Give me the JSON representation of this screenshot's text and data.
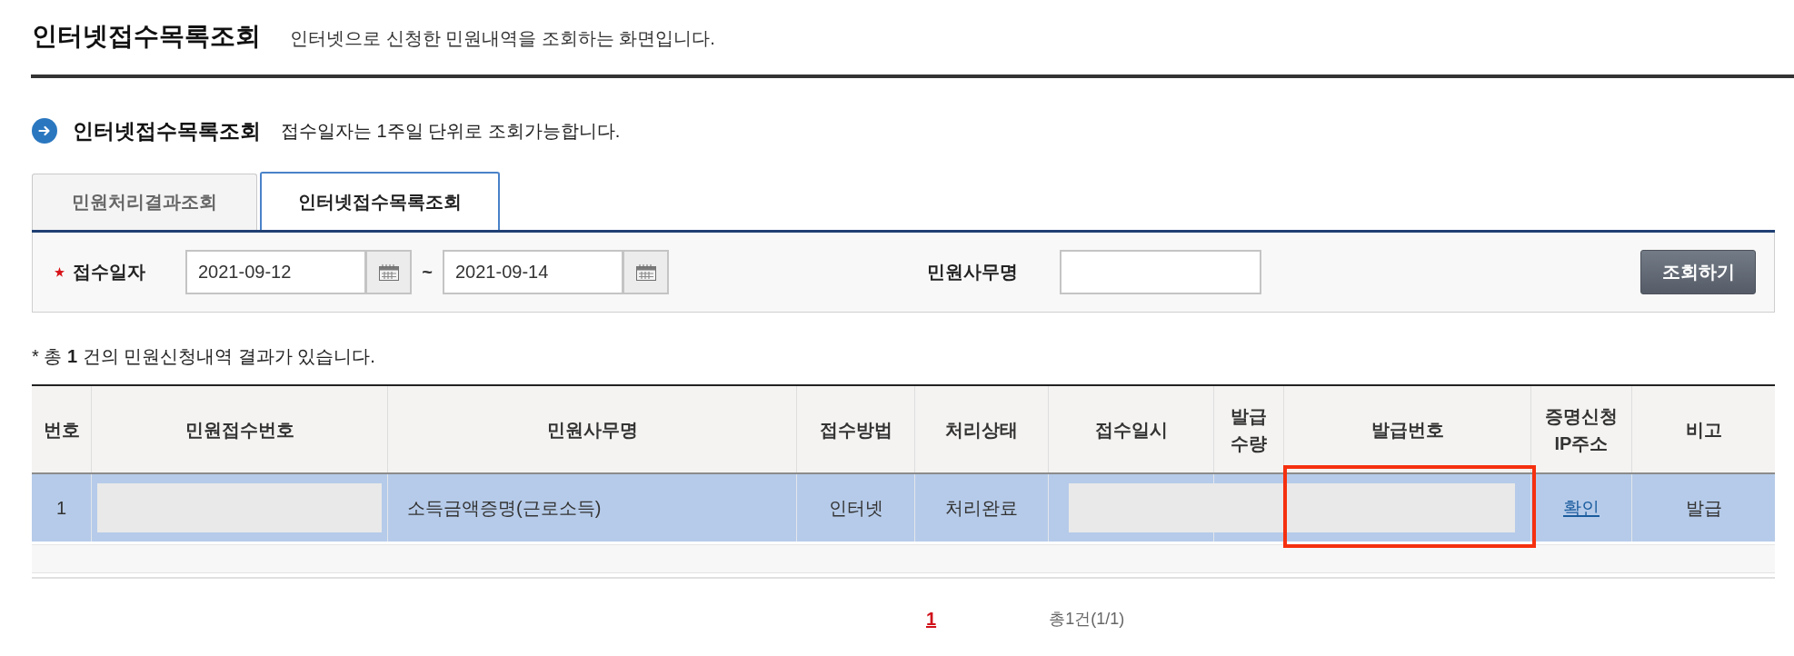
{
  "page_header": {
    "title": "인터넷접수목록조회",
    "description": "인터넷으로 신청한 민원내역을 조회하는 화면입니다."
  },
  "section": {
    "title": "인터넷접수목록조회",
    "note": "접수일자는 1주일 단위로 조회가능합니다."
  },
  "tabs": [
    {
      "label": "민원처리결과조회",
      "selected": false
    },
    {
      "label": "인터넷접수목록조회",
      "selected": true
    }
  ],
  "search": {
    "date_label": "접수일자",
    "required": true,
    "date_from": "2021-09-12",
    "range_separator": "~",
    "date_to": "2021-09-14",
    "name_label": "민원사무명",
    "button": "조회하기"
  },
  "result_summary": "* 총 **1** 건의 민원신청내역 결과가 있습니다.",
  "table": {
    "columns": [
      "번호",
      "민원접수번호",
      "민원사무명",
      "접수방법",
      "처리상태",
      "접수일시",
      "발급 수량",
      "발급번호",
      "증명신청 IP주소",
      "비고"
    ],
    "rows": [
      {
        "selected": true,
        "cells": [
          {
            "kind": "text",
            "text": "1",
            "marked": false
          },
          {
            "kind": "redacted",
            "marked": false
          },
          {
            "kind": "text",
            "text": "소득금액증명(근로소득)",
            "marked": false
          },
          {
            "kind": "text",
            "text": "인터넷",
            "marked": false
          },
          {
            "kind": "text",
            "text": "처리완료",
            "marked": false
          },
          {
            "kind": "redacted",
            "marked": false
          },
          {
            "kind": "redacted",
            "marked": false
          },
          {
            "kind": "redacted",
            "marked": true
          },
          {
            "kind": "link",
            "text": "확인",
            "marked": false
          },
          {
            "kind": "text",
            "text": "발급",
            "marked": false
          }
        ]
      }
    ]
  },
  "pagination": {
    "pages": [
      {
        "label": "1",
        "selected": true
      }
    ],
    "total": "총1건(1/1)"
  }
}
